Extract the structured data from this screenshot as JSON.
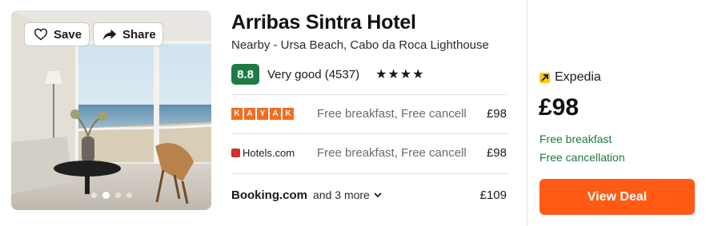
{
  "photo": {
    "save_label": "Save",
    "share_label": "Share",
    "carousel_count": 4,
    "carousel_active": 2
  },
  "hotel": {
    "name": "Arribas Sintra Hotel",
    "nearby": "Nearby - Ursa Beach, Cabo da Roca Lighthouse",
    "score": "8.8",
    "rating_text": "Very good (4537)",
    "stars": "★★★★",
    "star_count": 4
  },
  "offers": [
    {
      "provider": "KAYAK",
      "provider_icon": "kayak-logo",
      "description": "Free breakfast, Free cancell...",
      "price": "£98"
    },
    {
      "provider": "Hotels.com",
      "provider_icon": "hotels-logo",
      "description": "Free breakfast, Free cancell...",
      "price": "£98"
    }
  ],
  "booking": {
    "name": "Booking.com",
    "more": "and 3 more",
    "price": "£109"
  },
  "deal": {
    "provider": "Expedia",
    "price": "£98",
    "perks": [
      "Free breakfast",
      "Free cancellation"
    ],
    "button_label": "View Deal"
  },
  "colors": {
    "score_bg": "#1e7a46",
    "perk_text": "#1d7a3f",
    "cta": "#ff5b14",
    "kayak": "#f36c21",
    "expedia": "#ffcc00"
  }
}
